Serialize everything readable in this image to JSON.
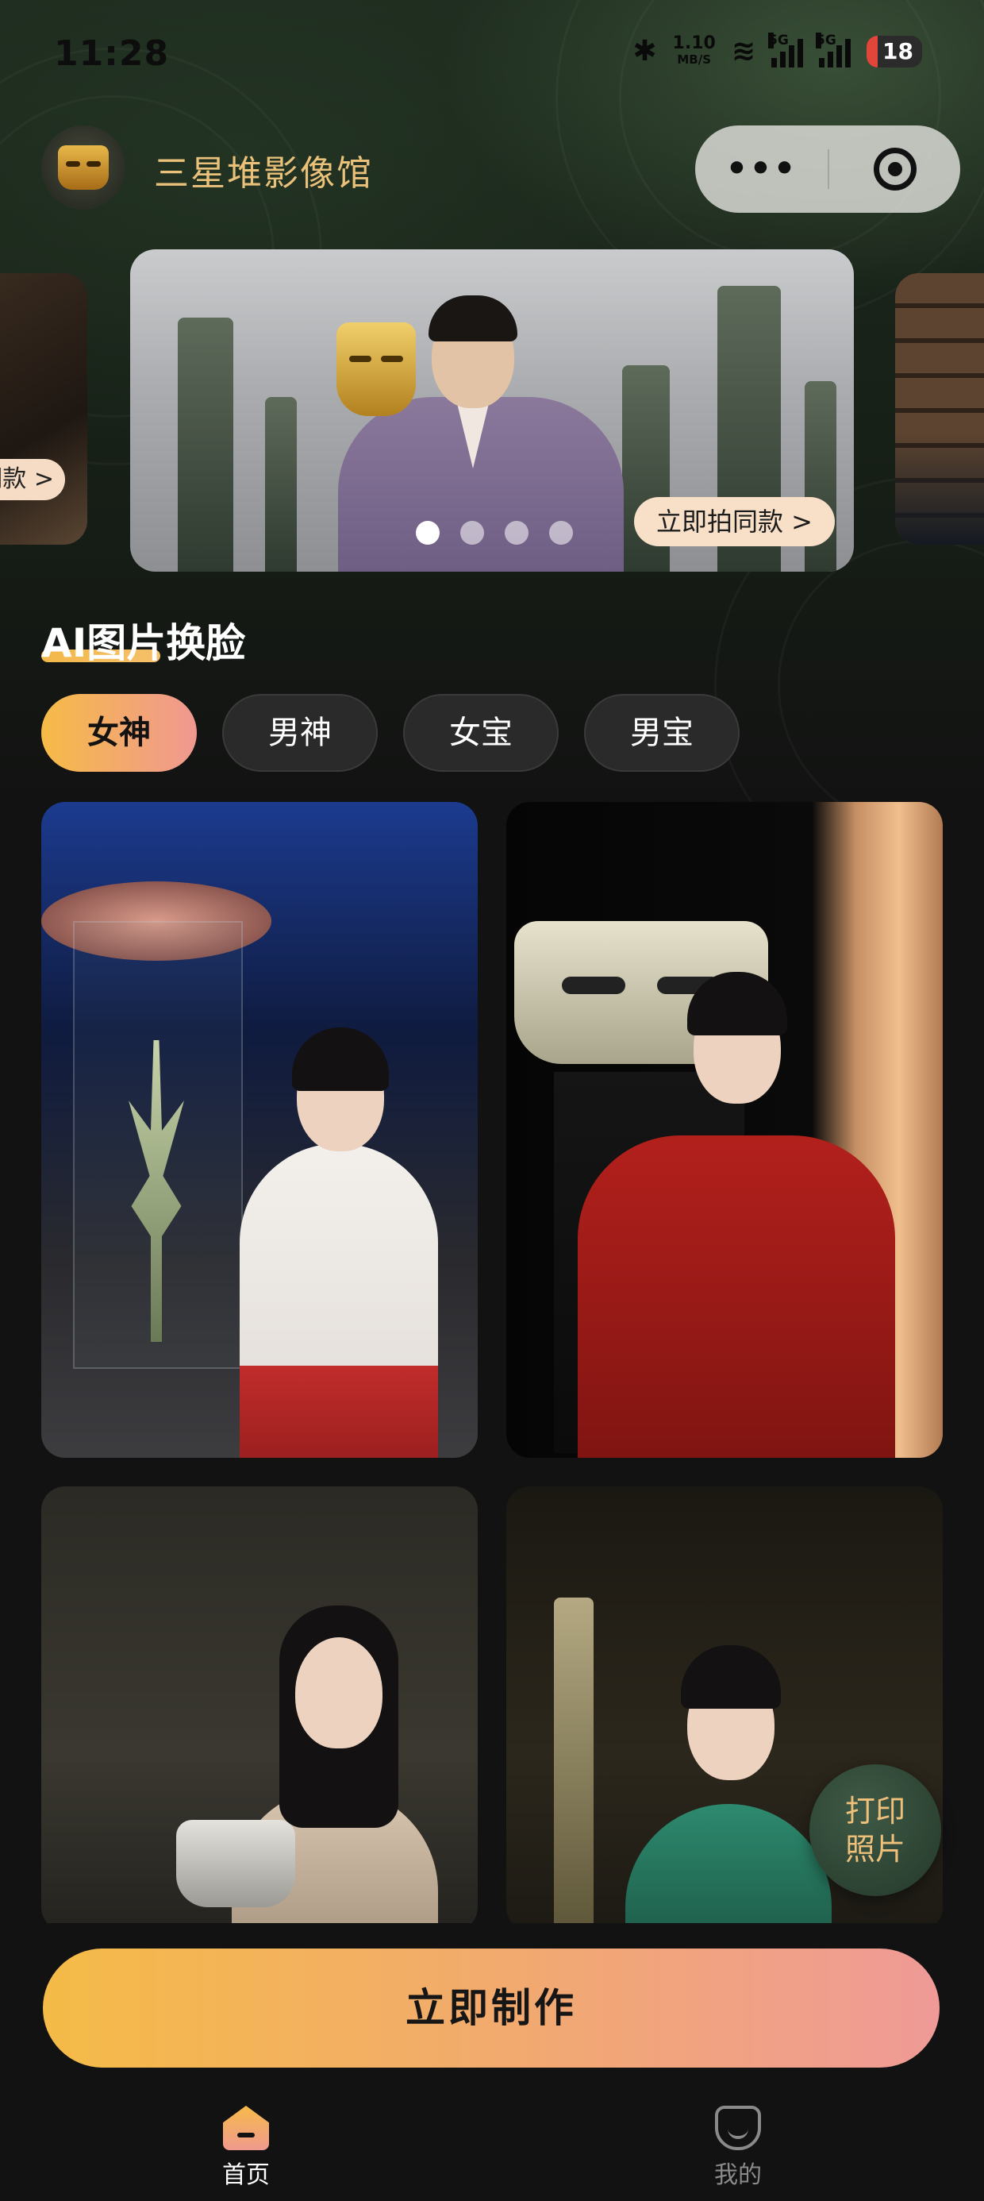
{
  "status_bar": {
    "time": "11:28",
    "net_speed_value": "1.10",
    "net_speed_unit": "MB/S",
    "signal_1": "5G",
    "signal_2": "5G",
    "battery": "18"
  },
  "header": {
    "app_title": "三星堆影像馆",
    "more_label": "•••"
  },
  "banner": {
    "left_card_button": "同款 >",
    "main_button": "立即拍同款 >",
    "dots_count": 4,
    "active_dot": 1
  },
  "section": {
    "title": "AI图片换脸"
  },
  "tabs": [
    {
      "label": "女神",
      "active": true
    },
    {
      "label": "男神",
      "active": false
    },
    {
      "label": "女宝",
      "active": false
    },
    {
      "label": "男宝",
      "active": false
    }
  ],
  "print_badge": {
    "line1": "打印",
    "line2": "照片"
  },
  "make_button": {
    "label": "立即制作"
  },
  "tabbar": [
    {
      "label": "首页",
      "icon": "home-icon",
      "active": true
    },
    {
      "label": "我的",
      "icon": "smile-icon",
      "active": false
    }
  ],
  "colors": {
    "accent_start": "#f4bb47",
    "accent_end": "#ef9a97",
    "title_gold": "#e9c17a"
  }
}
